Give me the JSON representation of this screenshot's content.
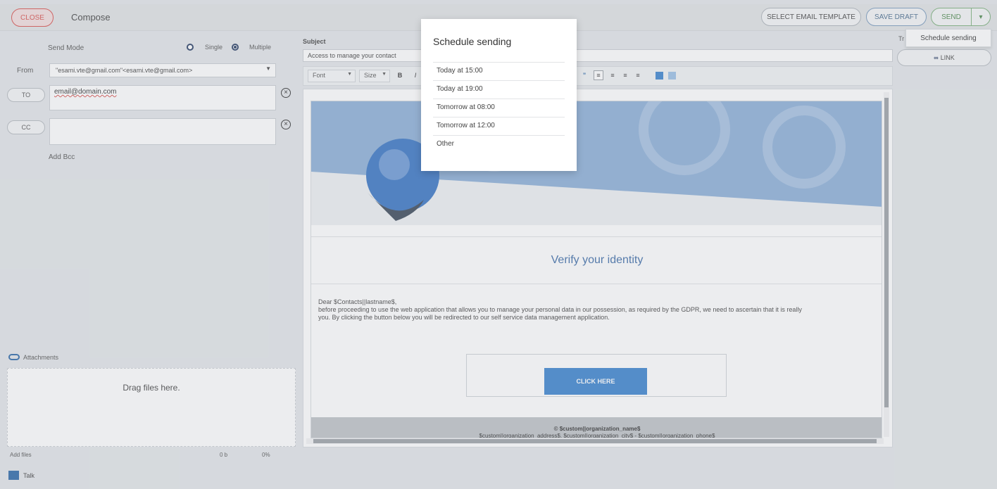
{
  "header": {
    "close_label": "CLOSE",
    "title": "Compose",
    "select_template_label": "SELECT EMAIL TEMPLATE",
    "save_draft_label": "SAVE DRAFT",
    "send_label": "SEND",
    "send_caret": "▾"
  },
  "dropdown_send": {
    "schedule_label": "Schedule sending"
  },
  "left": {
    "send_mode_label": "Send Mode",
    "single_label": "Single",
    "multiple_label": "Multiple",
    "selected_mode": "Multiple",
    "from_label": "From",
    "from_value": "\"esami.vte@gmail.com\"<esami.vte@gmail.com>",
    "to_label": "TO",
    "to_value": "email@domain.com",
    "cc_label": "CC",
    "cc_value": "",
    "add_bcc_label": "Add Bcc",
    "attachments_label": "Attachments",
    "dropzone_text": "Drag files here.",
    "add_files_label": "Add files",
    "size_text": "0 b",
    "percent_text": "0%"
  },
  "center": {
    "subject_label": "Subject",
    "subject_value": "Access to manage your contact",
    "toolbar": {
      "font_label": "Font",
      "size_label": "Size",
      "bold": "B",
      "italic": "I"
    },
    "email": {
      "verify_title": "Verify your identity",
      "body_line1": "Dear $Contacts||lastname$,",
      "body_line2": "before proceeding to use the web application that allows you to manage your personal data in our possession, as required by the GDPR, we need to ascertain that it is really",
      "body_line3": "you. By clicking the button below you will be redirected to our self service data management application.",
      "button_label": "CLICK HERE",
      "footer_line1": "© $custom||organization_name$",
      "footer_line2": "$custom||organization_address$, $custom||organization_city$ - $custom||organization_phone$"
    }
  },
  "right": {
    "tr_label": "Tr",
    "link_label": "LINK"
  },
  "modal": {
    "title": "Schedule sending",
    "options": [
      "Today at 15:00",
      "Today at 19:00",
      "Tomorrow at 08:00",
      "Tomorrow at 12:00",
      "Other"
    ]
  },
  "footer": {
    "talk_label": "Talk"
  },
  "colors": {
    "accent_blue": "#3d84cf",
    "close_red": "#d9534f",
    "send_green": "#4e8a4e"
  }
}
